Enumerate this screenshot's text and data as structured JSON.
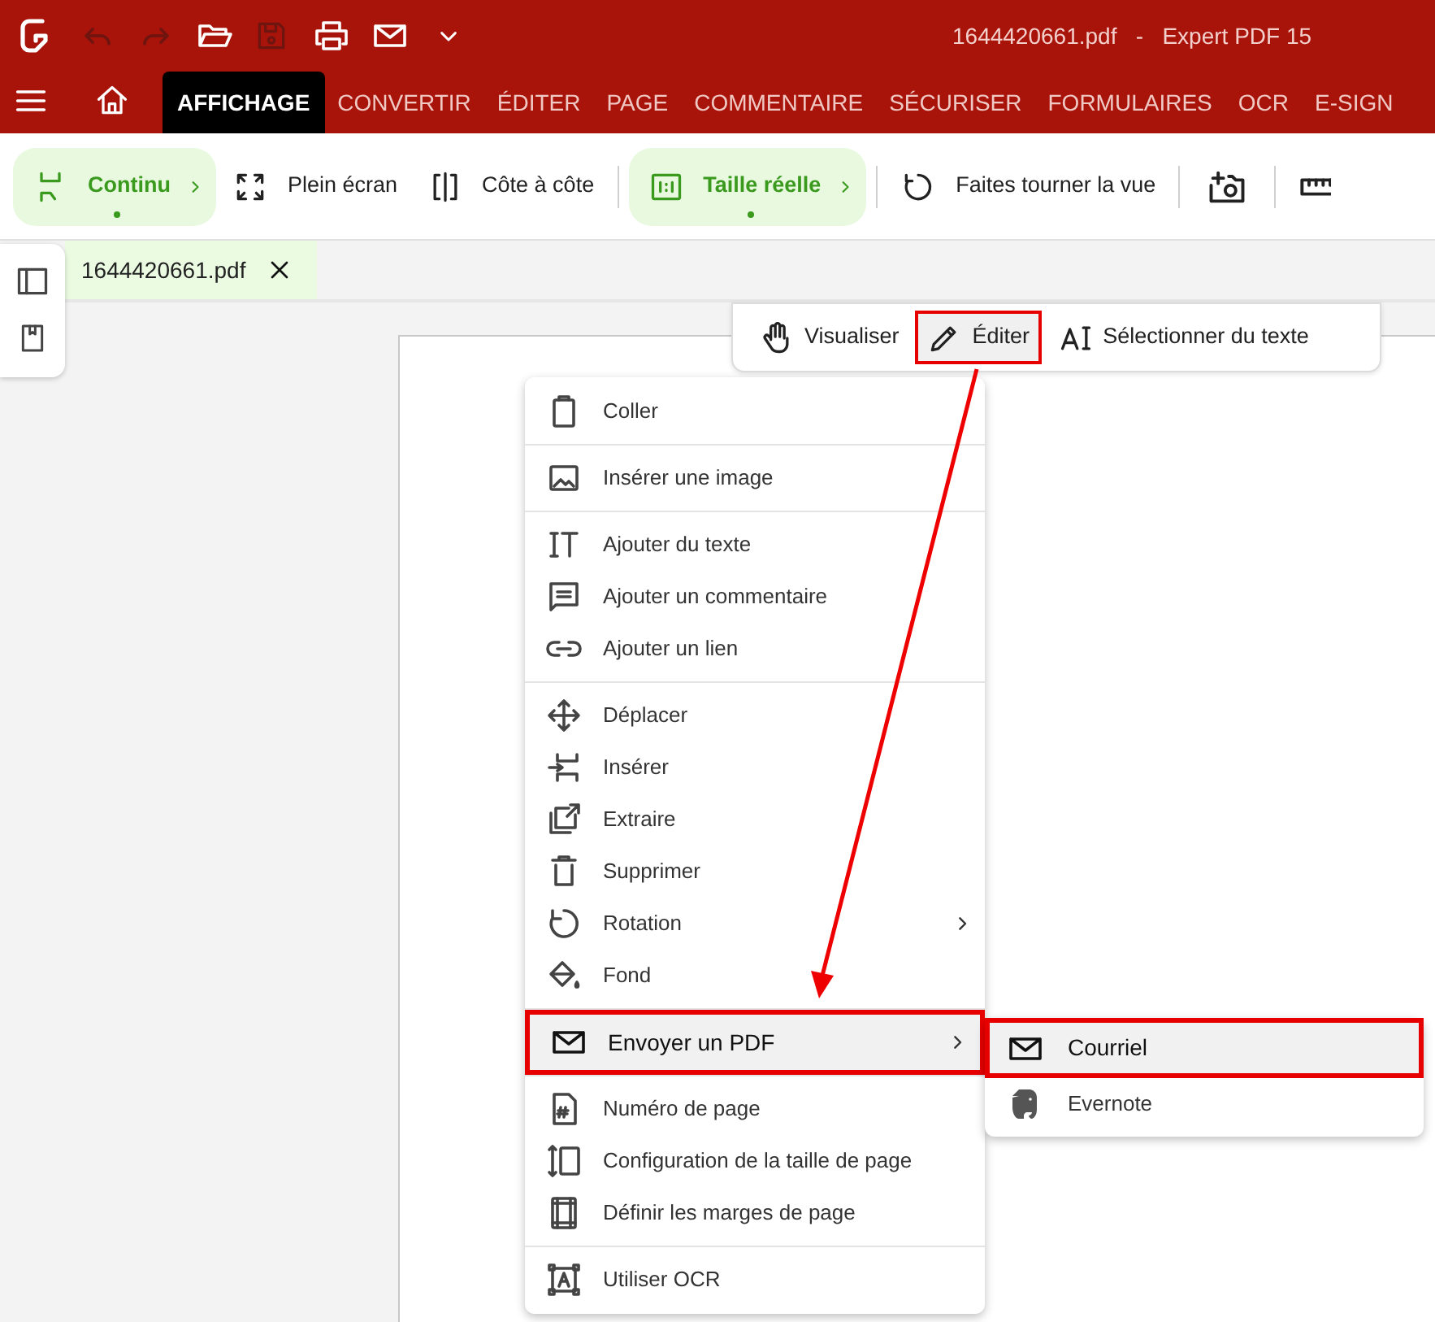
{
  "title_bar": {
    "title": "1644420661.pdf   -   Expert PDF 15"
  },
  "ribbon_tabs": [
    {
      "label": "AFFICHAGE",
      "selected": true
    },
    {
      "label": "CONVERTIR",
      "selected": false
    },
    {
      "label": "ÉDITER",
      "selected": false
    },
    {
      "label": "PAGE",
      "selected": false
    },
    {
      "label": "COMMENTAIRE",
      "selected": false
    },
    {
      "label": "SÉCURISER",
      "selected": false
    },
    {
      "label": "FORMULAIRES",
      "selected": false
    },
    {
      "label": "OCR",
      "selected": false
    },
    {
      "label": "E-SIGN",
      "selected": false
    }
  ],
  "toolbar": [
    {
      "kind": "toggle",
      "label": "Continu",
      "selected": true
    },
    {
      "kind": "button",
      "label": "Plein écran"
    },
    {
      "kind": "button",
      "label": "Côte à côte"
    },
    {
      "kind": "toggle",
      "label": "Taille réelle",
      "selected": true
    },
    {
      "kind": "button",
      "label": "Faites tourner la vue"
    }
  ],
  "document_tab": {
    "label": "1644420661.pdf"
  },
  "mode_bar": [
    {
      "label": "Visualiser",
      "selected": false
    },
    {
      "label": "Éditer",
      "selected": true
    },
    {
      "label": "Sélectionner du texte",
      "selected": false
    }
  ],
  "context_menu": {
    "groups": [
      [
        {
          "label": "Coller"
        }
      ],
      [
        {
          "label": "Insérer une image"
        }
      ],
      [
        {
          "label": "Ajouter du texte"
        },
        {
          "label": "Ajouter un commentaire"
        },
        {
          "label": "Ajouter un lien"
        }
      ],
      [
        {
          "label": "Déplacer"
        },
        {
          "label": "Insérer"
        },
        {
          "label": "Extraire"
        },
        {
          "label": "Supprimer"
        },
        {
          "label": "Rotation",
          "submenu": true
        },
        {
          "label": "Fond"
        }
      ],
      [
        {
          "label": "Envoyer un PDF",
          "submenu": true,
          "selected": true
        }
      ],
      [
        {
          "label": "Numéro de page"
        },
        {
          "label": "Configuration de la taille de page"
        },
        {
          "label": "Définir les marges de page"
        }
      ],
      [
        {
          "label": "Utiliser OCR"
        }
      ]
    ]
  },
  "submenu": [
    {
      "label": "Courriel",
      "selected": true
    },
    {
      "label": "Evernote",
      "selected": false
    }
  ]
}
